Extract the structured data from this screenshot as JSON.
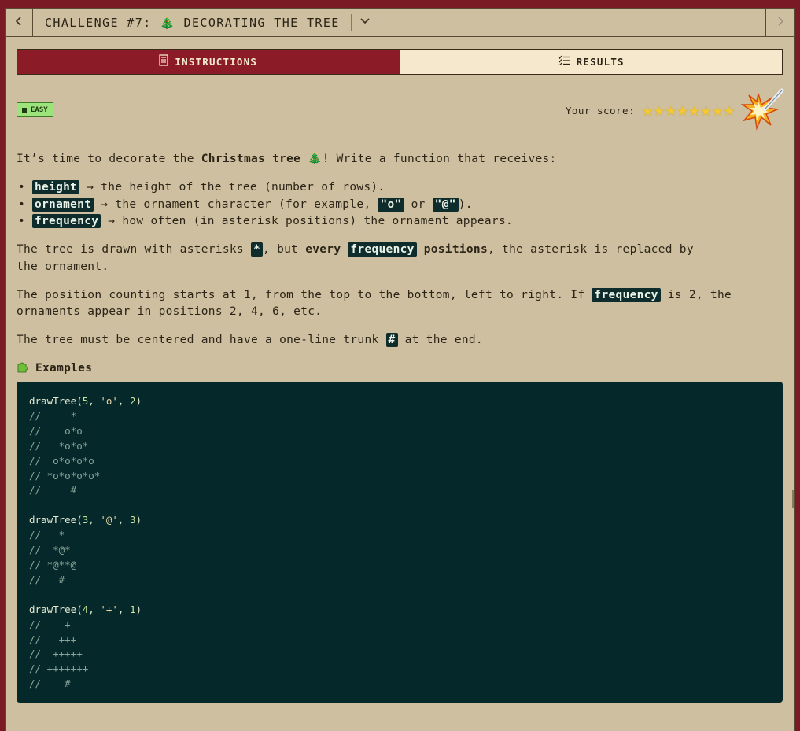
{
  "header": {
    "title": "CHALLENGE #7: 🎄 DECORATING THE TREE",
    "prev_icon": "chevron-left-icon",
    "next_icon": "chevron-right-icon",
    "dropdown_icon": "chevron-down-icon"
  },
  "tabs": [
    {
      "label": "INSTRUCTIONS",
      "icon": "list-icon",
      "active": true
    },
    {
      "label": "RESULTS",
      "icon": "checklist-icon",
      "active": false
    }
  ],
  "badge": {
    "label": "EASY",
    "color": "#9be37a"
  },
  "score": {
    "label": "Your score:",
    "stars": 8,
    "max_stars": 8
  },
  "colors": {
    "accent": "#8b1c27",
    "background": "#cdbf9f",
    "code_bg": "#05292a",
    "star": "#f4c935"
  },
  "intro": {
    "before": "It’s time to decorate the ",
    "bold": "Christmas tree",
    "after": " 🎄! Write a function that receives:"
  },
  "params": [
    {
      "name": "height",
      "desc": " → the height of the tree (number of rows)."
    },
    {
      "name": "ornament",
      "desc": " → the ornament character (for example, ",
      "ex1": "\"o\"",
      "mid": " or ",
      "ex2": "\"@\"",
      "end": ")."
    },
    {
      "name": "frequency",
      "desc": " → how often (in asterisk positions) the ornament appears."
    }
  ],
  "para_tree": {
    "p1": "The tree is drawn with asterisks ",
    "chip1": "*",
    "p2": ", but ",
    "bold1": "every",
    "chip2": "frequency",
    "bold2": "positions",
    "p3": ", the asterisk is replaced by",
    "line2": "the ornament."
  },
  "para_count": {
    "p1": "The position counting starts at 1, from the top to the bottom, left to right. If ",
    "chip": "frequency",
    "p2": " is 2, the",
    "line2": "ornaments appear in positions 2, 4, 6, etc."
  },
  "para_trunk": {
    "p1": "The tree must be centered and have a one-line trunk ",
    "chip": "#",
    "p2": " at the end."
  },
  "examples_heading": {
    "icon": "puzzle-icon",
    "label": "Examples"
  },
  "examples": [
    {
      "call": "drawTree(5, 'o', 2)",
      "output": [
        "//     *",
        "//    o*o",
        "//   *o*o*",
        "//  o*o*o*o",
        "// *o*o*o*o*",
        "//     #"
      ]
    },
    {
      "call": "drawTree(3, '@', 3)",
      "output": [
        "//   *",
        "//  *@*",
        "// *@**@",
        "//   #"
      ]
    },
    {
      "call": "drawTree(4, '+', 1)",
      "output": [
        "//    +",
        "//   +++",
        "//  +++++",
        "// +++++++",
        "//    #"
      ]
    }
  ]
}
